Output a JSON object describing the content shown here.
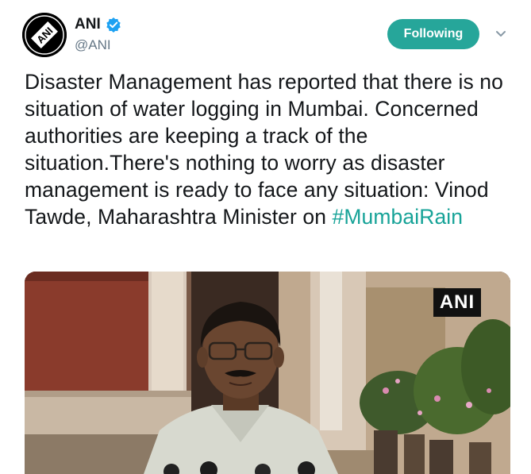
{
  "account": {
    "display_name": "ANI",
    "handle": "@ANI",
    "avatar_text": "ANI",
    "verified": true
  },
  "actions": {
    "follow_label": "Following",
    "caret": "chevron-down-icon"
  },
  "tweet": {
    "text": "Disaster Management has reported that there is no situation of water logging in Mumbai. Concerned authorities are keeping a track of the situation.There's nothing to worry as disaster management is ready to face any situation: Vinod Tawde, Maharashtra Minister on",
    "hashtag": "#MumbaiRain"
  },
  "media": {
    "watermark": "ANI"
  },
  "colors": {
    "accent": "#26a69a",
    "hashtag": "#17a398",
    "verified": "#1da1f2",
    "handle": "#657786"
  }
}
